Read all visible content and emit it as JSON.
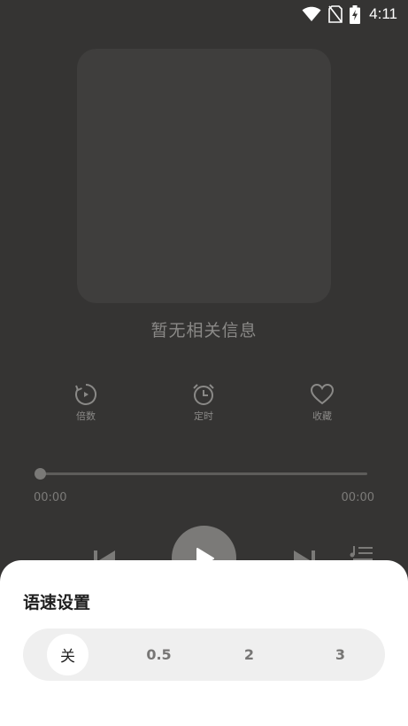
{
  "status_bar": {
    "time": "4:11"
  },
  "player": {
    "no_info_text": "暂无相关信息",
    "actions": [
      {
        "label": "倍数",
        "icon": "speed-icon"
      },
      {
        "label": "定时",
        "icon": "alarm-clock-icon"
      },
      {
        "label": "收藏",
        "icon": "heart-icon"
      }
    ],
    "current_time": "00:00",
    "total_time": "00:00",
    "progress": 0
  },
  "speed_sheet": {
    "title": "语速设置",
    "options": [
      "关",
      "0.5",
      "2",
      "3"
    ],
    "selected_index": 0
  },
  "colors": {
    "background": "#353433",
    "sheet_background": "#ffffff",
    "accent_gray": "#7b7a78"
  }
}
